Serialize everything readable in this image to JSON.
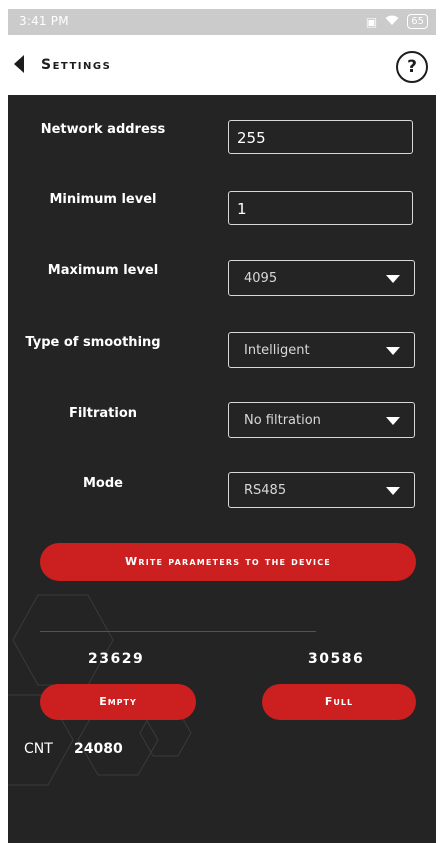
{
  "status_bar": {
    "time": "3:41 PM",
    "battery": "65"
  },
  "header": {
    "title": "Settings",
    "help": "?"
  },
  "form": {
    "network_address": {
      "label": "Network address",
      "value": "255"
    },
    "minimum_level": {
      "label": "Minimum level",
      "value": "1"
    },
    "maximum_level": {
      "label": "Maximum level",
      "selected": "4095"
    },
    "type_of_smoothing": {
      "label": "Type of smoothing",
      "selected": "Intelligent"
    },
    "filtration": {
      "label": "Filtration",
      "selected": "No filtration"
    },
    "mode": {
      "label": "Mode",
      "selected": "RS485"
    }
  },
  "write_button": "Write parameters to the device",
  "calibration": {
    "empty_value": "23629",
    "full_value": "30586",
    "empty_label": "Empty",
    "full_label": "Full"
  },
  "counter": {
    "label": "CNT",
    "value": "24080"
  },
  "colors": {
    "accent": "#cc1f1f",
    "background": "#242424",
    "header_background": "#ffffff"
  }
}
